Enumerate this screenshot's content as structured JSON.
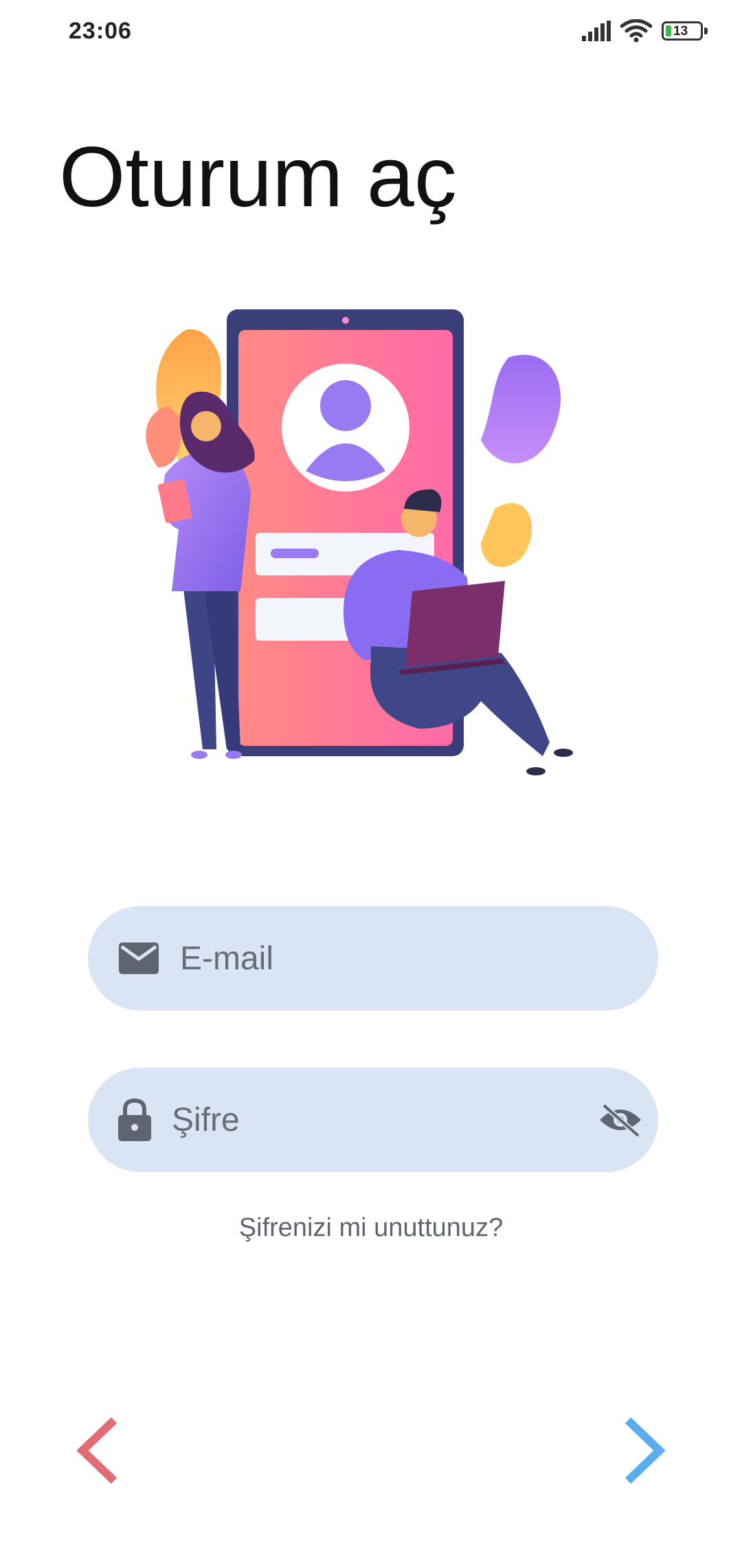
{
  "status_bar": {
    "time": "23:06",
    "battery_level": "13",
    "icons": [
      "signal-icon",
      "wifi-icon",
      "battery-icon"
    ]
  },
  "page": {
    "title": "Oturum aç"
  },
  "form": {
    "email": {
      "placeholder": "E-mail",
      "value": "",
      "icon": "mail-icon"
    },
    "password": {
      "placeholder": "Şifre",
      "value": "",
      "icon": "lock-icon",
      "toggle_icon": "eye-off-icon"
    },
    "forgot_link": "Şifrenizi mi unuttunuz?"
  },
  "navigation": {
    "back_icon": "chevron-left-icon",
    "next_icon": "chevron-right-icon"
  },
  "colors": {
    "field_bg": "#d9e4f5",
    "back_arrow": "#e06c75",
    "next_arrow": "#5aaef0",
    "title": "#111111"
  }
}
